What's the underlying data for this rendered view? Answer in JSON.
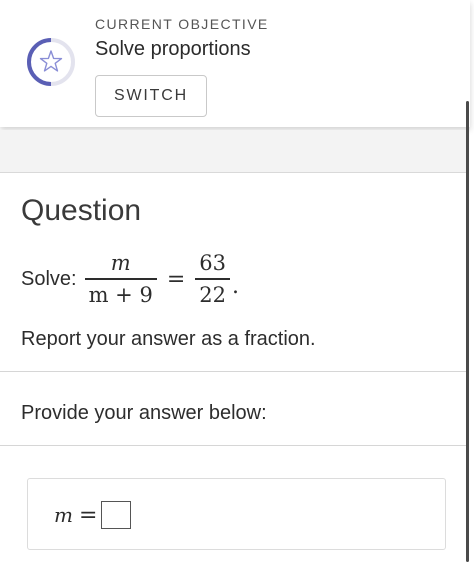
{
  "objective": {
    "label": "CURRENT OBJECTIVE",
    "title": "Solve proportions",
    "switch_label": "SWITCH",
    "progress_fraction": 0.5,
    "ring_color": "#5a5fb5",
    "star_color": "#8a8ed6"
  },
  "question": {
    "heading": "Question",
    "solve_label": "Solve:",
    "lhs_numerator": "m",
    "lhs_denominator": "m + 9",
    "equals": "=",
    "rhs_numerator": "63",
    "rhs_denominator": "22",
    "period": ".",
    "instruction": "Report your answer as a fraction."
  },
  "answer": {
    "prompt": "Provide your answer below:",
    "variable": "m",
    "equals": "=",
    "input_value": ""
  }
}
